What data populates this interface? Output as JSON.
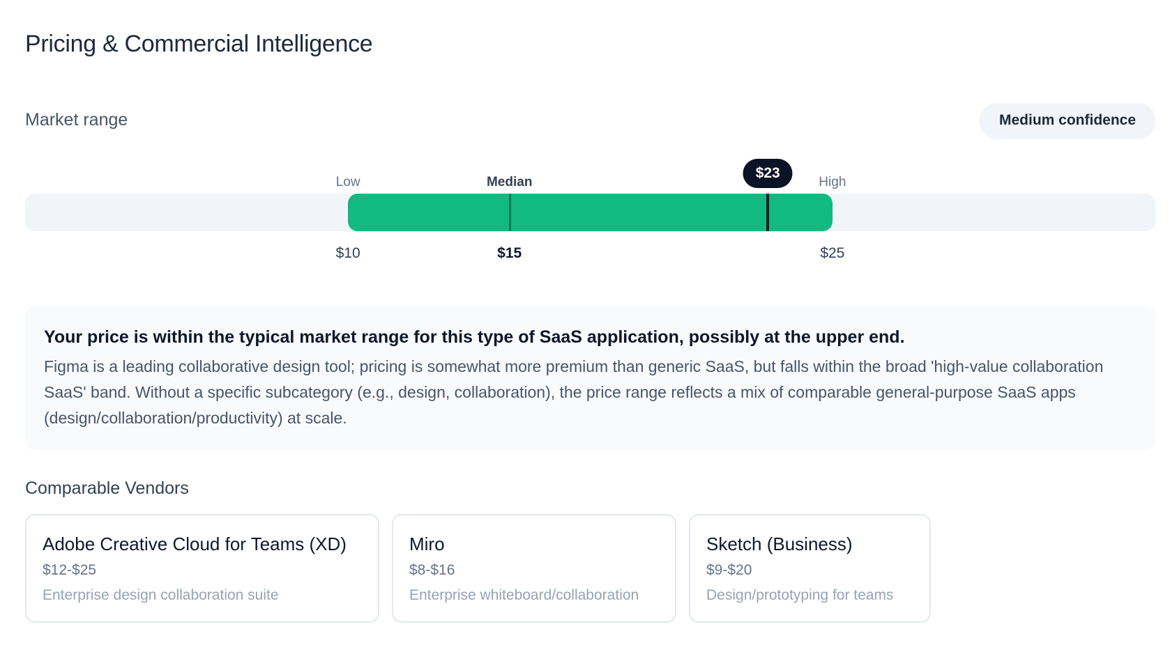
{
  "page": {
    "title": "Pricing & Commercial Intelligence"
  },
  "market_range": {
    "label": "Market range",
    "confidence": "Medium confidence",
    "low_label": "Low",
    "median_label": "Median",
    "high_label": "High",
    "low_value": "$10",
    "median_value": "$15",
    "high_value": "$25",
    "your_price_label": "$23",
    "low": 10,
    "median": 15,
    "high": 25,
    "your_price": 23,
    "scale_min": 0,
    "scale_max": 35,
    "colors": {
      "track": "#f1f5f9",
      "range": "#12b981",
      "median": "#0d7a55",
      "your_price": "#0b1426"
    }
  },
  "analysis": {
    "headline": "Your price is within the typical market range for this type of SaaS application, possibly at the upper end.",
    "body": "Figma is a leading collaborative design tool; pricing is somewhat more premium than generic SaaS, but falls within the broad 'high-value collaboration SaaS' band. Without a specific subcategory (e.g., design, collaboration), the price range reflects a mix of comparable general-purpose SaaS apps (design/collaboration/productivity) at scale."
  },
  "vendors": {
    "heading": "Comparable Vendors",
    "items": [
      {
        "name": "Adobe Creative Cloud for Teams (XD)",
        "price": "$12-$25",
        "description": "Enterprise design collaboration suite"
      },
      {
        "name": "Miro",
        "price": "$8-$16",
        "description": "Enterprise whiteboard/collaboration"
      },
      {
        "name": "Sketch (Business)",
        "price": "$9-$20",
        "description": "Design/prototyping for teams"
      }
    ]
  }
}
